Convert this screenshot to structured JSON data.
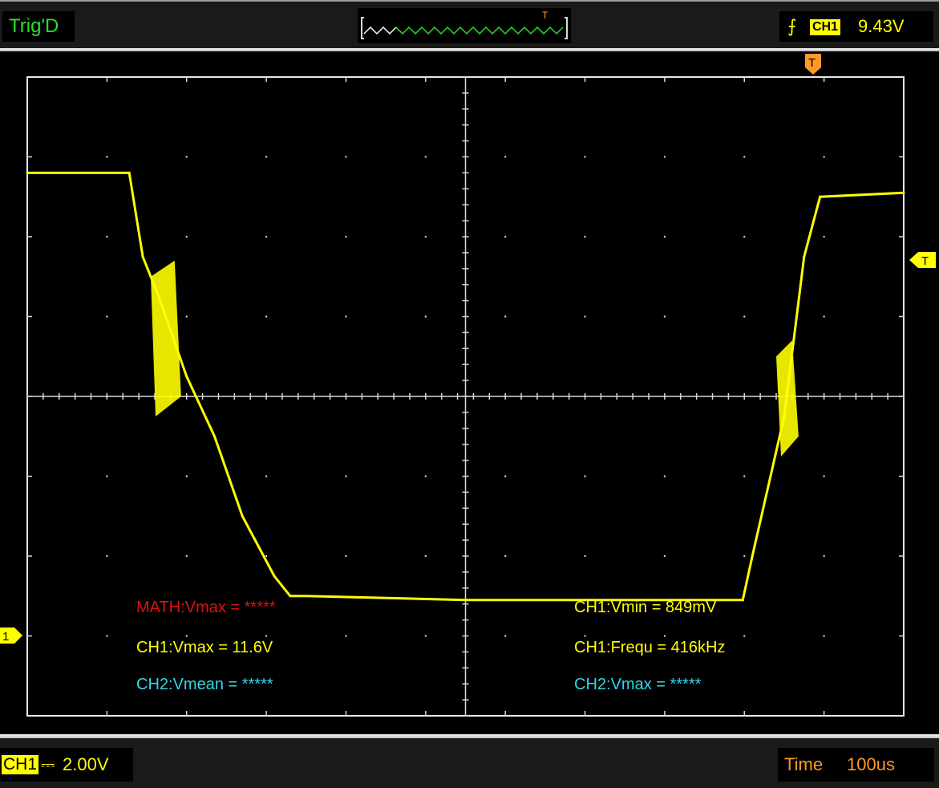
{
  "top": {
    "trig_status": "Trig'D",
    "mini_trigger_marker": "T",
    "trigger_edge_icon": "rising-edge-icon",
    "trigger_channel": "CH1",
    "trigger_level": "9.43V"
  },
  "markers": {
    "time_trigger": "T",
    "level_trigger": "T",
    "ch1_ground": "1"
  },
  "measurements": {
    "math_vmax": "MATH:Vmax = *****",
    "ch1_vmax": "CH1:Vmax = 11.6V",
    "ch2_vmean": "CH2:Vmean = *****",
    "ch1_vmin": "CH1:Vmin = 849mV",
    "ch1_freq": "CH1:Frequ = 416kHz",
    "ch2_vmax": "CH2:Vmax = *****"
  },
  "bottom": {
    "ch1_label": "CH1",
    "ch1_coupling": "⎓",
    "ch1_scale": "2.00V",
    "time_label": "Time",
    "time_base": "100us"
  },
  "colors": {
    "ch1": "#ffff00",
    "math": "#e01010",
    "ch2": "#30d8e8",
    "trigger_marker": "#ff9a2a",
    "status_green": "#28e028"
  },
  "chart_data": {
    "type": "line",
    "x_unit": "divisions",
    "y_unit": "V",
    "xlim": [
      0,
      11
    ],
    "ylim": [
      -8,
      8
    ],
    "series": [
      {
        "name": "CH1",
        "x": [
          0.0,
          1.28,
          1.45,
          1.65,
          2.0,
          2.35,
          2.7,
          3.1,
          3.3,
          3.5,
          5.5,
          7.0,
          8.98,
          9.1,
          9.5,
          9.75,
          9.95,
          11.0
        ],
        "y": [
          5.6,
          5.6,
          3.5,
          2.5,
          0.5,
          -1.0,
          -3.0,
          -4.5,
          -5.0,
          -5.0,
          -5.1,
          -5.1,
          -5.1,
          -4.0,
          -0.5,
          3.5,
          5.0,
          5.1
        ]
      }
    ]
  }
}
